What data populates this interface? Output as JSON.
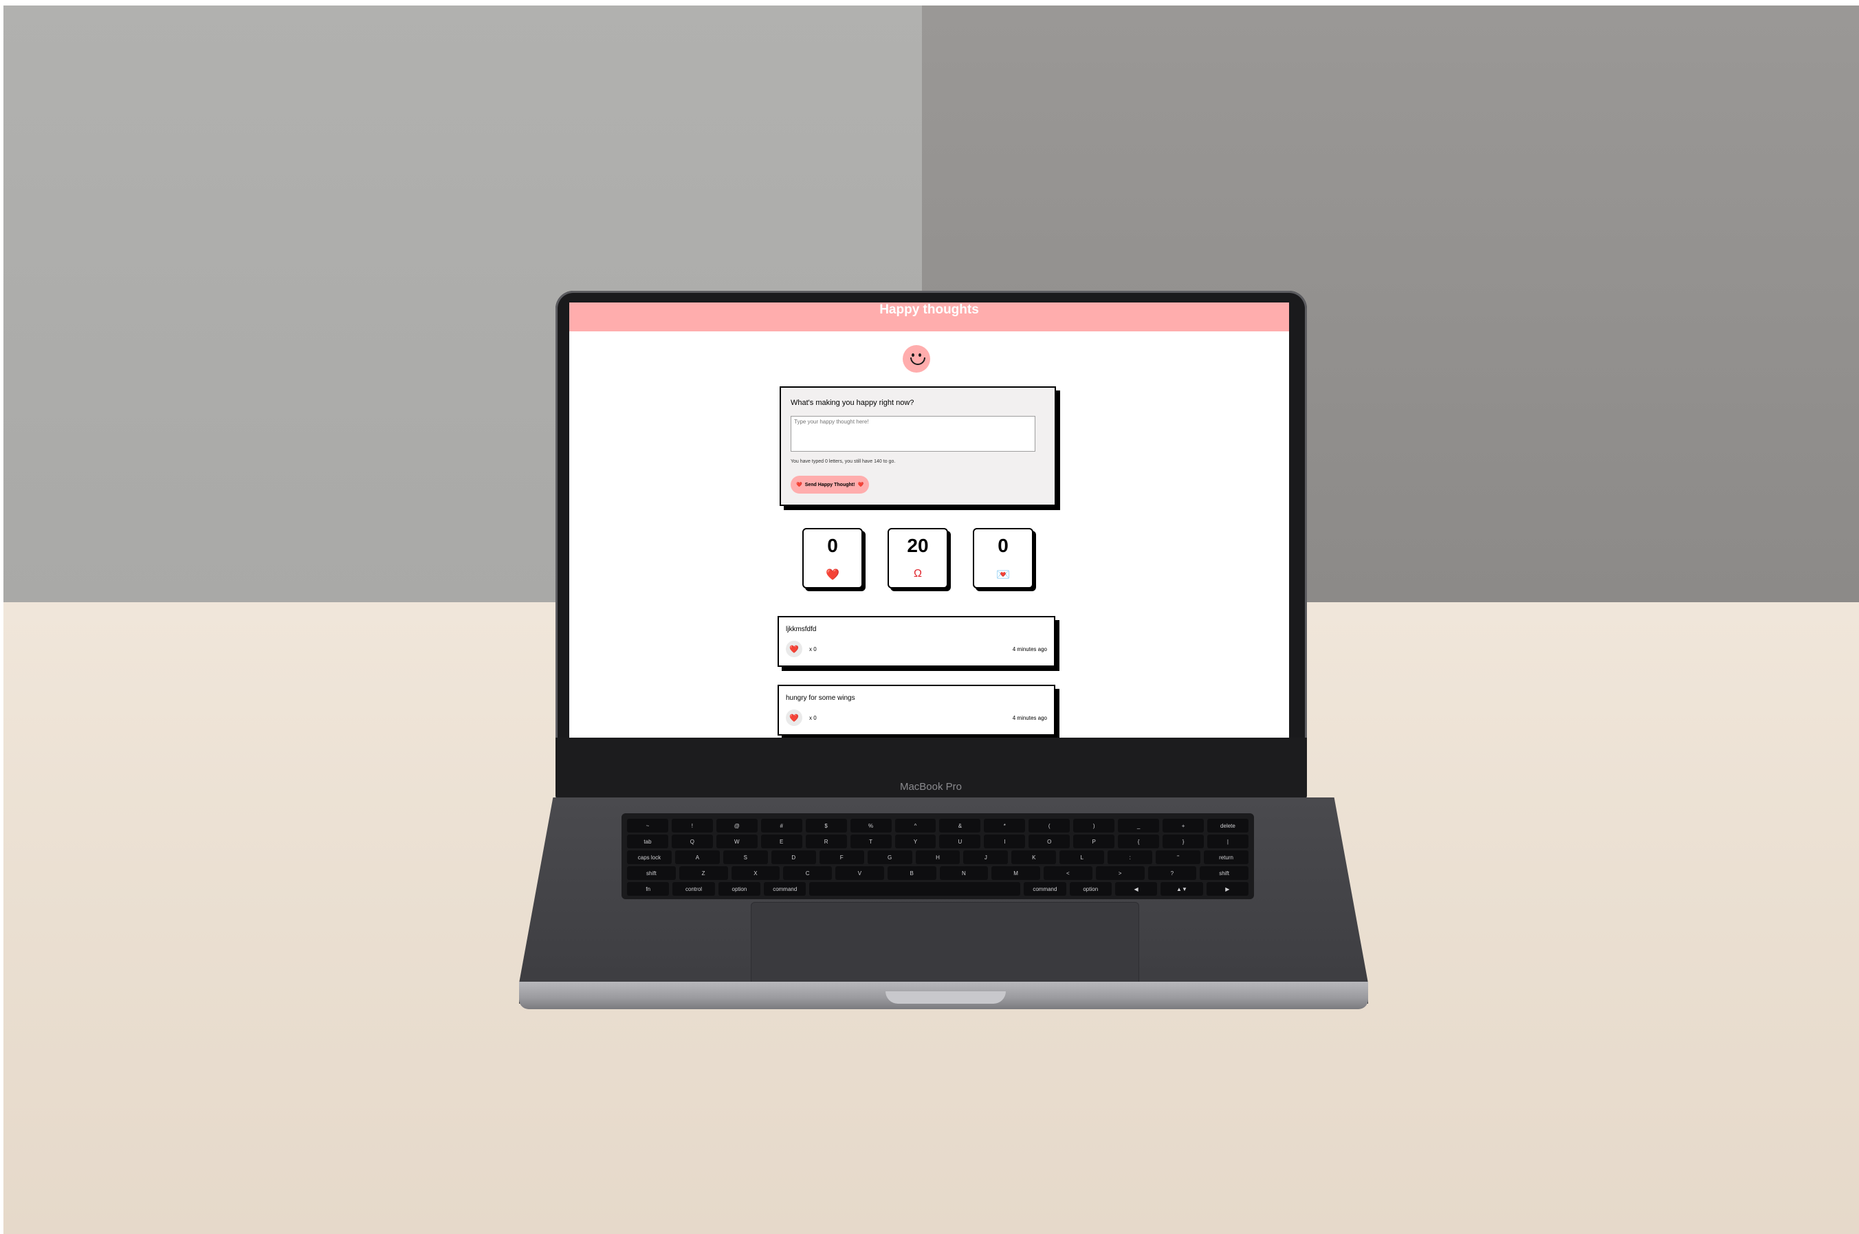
{
  "app": {
    "title": "Happy thoughts",
    "brand": "MacBook Pro"
  },
  "form": {
    "question": "What's making you happy right now?",
    "placeholder": "Type your happy thought here!",
    "counter": "You have typed 0 letters, you still have 140 to go.",
    "send_label": "Send Happy Thought!",
    "send_icon": "❤️"
  },
  "stats": [
    {
      "value": "0",
      "icon": "❤️"
    },
    {
      "value": "20",
      "icon": "Ω"
    },
    {
      "value": "0",
      "icon": "💌"
    }
  ],
  "thoughts": [
    {
      "message": "ljkkmsfdfd",
      "likes": "x 0",
      "time": "4 minutes ago"
    },
    {
      "message": "hungry for some wings",
      "likes": "x 0",
      "time": "4 minutes ago"
    }
  ],
  "keyboard": {
    "row1": [
      "~",
      "!",
      "@",
      "#",
      "$",
      "%",
      "^",
      "&",
      "*",
      "(",
      ")",
      "_",
      "+",
      "delete"
    ],
    "row2": [
      "tab",
      "Q",
      "W",
      "E",
      "R",
      "T",
      "Y",
      "U",
      "I",
      "O",
      "P",
      "{",
      "}",
      "|"
    ],
    "row3": [
      "caps lock",
      "A",
      "S",
      "D",
      "F",
      "G",
      "H",
      "J",
      "K",
      "L",
      ":",
      "\"",
      "return"
    ],
    "row4": [
      "shift",
      "Z",
      "X",
      "C",
      "V",
      "B",
      "N",
      "M",
      "<",
      ">",
      "?",
      "shift"
    ],
    "row5": [
      "fn",
      "control",
      "option",
      "command",
      "",
      "command",
      "option",
      "◀",
      "▲▼",
      "▶"
    ]
  },
  "colors": {
    "accent": "#ffadad",
    "heart": "#e0252d"
  }
}
